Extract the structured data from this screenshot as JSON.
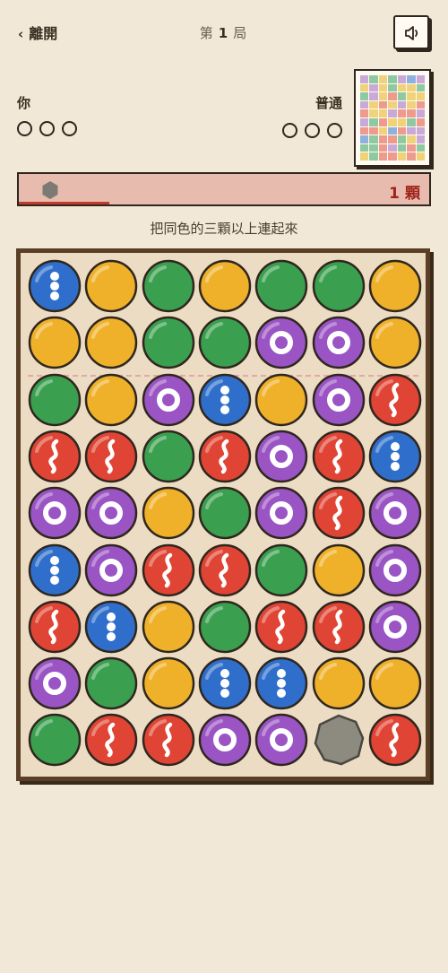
{
  "header": {
    "leave_label": "離開",
    "round_prefix": "第",
    "round_number": "1",
    "round_suffix": "局"
  },
  "players": {
    "you": {
      "label": "你",
      "lives": 3
    },
    "opponent": {
      "label": "普通",
      "lives": 3
    }
  },
  "progress": {
    "count": "1",
    "unit": "顆",
    "fraction": 0.22
  },
  "hint": "把同色的三顆以上連起來",
  "colors": {
    "blue": "#2f6fcb",
    "yellow": "#f0b12a",
    "green": "#3aa04f",
    "purple": "#9a54c4",
    "red": "#e04434",
    "stone": "#8d8a80",
    "board": "#ecdcc4",
    "progress_bg": "#e7bbae"
  },
  "board": {
    "columns": 7,
    "rows": [
      [
        "blue",
        "yellow",
        "green",
        "yellow",
        "green",
        "green",
        "yellow"
      ],
      [
        "yellow",
        "yellow",
        "green",
        "green",
        "purple",
        "purple",
        "yellow"
      ],
      [
        "green",
        "yellow",
        "purple",
        "blue",
        "yellow",
        "purple",
        "red"
      ],
      [
        "red",
        "red",
        "green",
        "red",
        "purple",
        "red",
        "blue"
      ],
      [
        "purple",
        "purple",
        "yellow",
        "green",
        "purple",
        "red",
        "purple"
      ],
      [
        "blue",
        "purple",
        "red",
        "red",
        "green",
        "yellow",
        "purple"
      ],
      [
        "red",
        "blue",
        "yellow",
        "green",
        "red",
        "red",
        "purple"
      ],
      [
        "purple",
        "green",
        "yellow",
        "blue",
        "blue",
        "yellow",
        "yellow"
      ],
      [
        "green",
        "red",
        "red",
        "purple",
        "purple",
        "stone",
        "red"
      ]
    ]
  },
  "minimap": {
    "rows": [
      [
        "purple",
        "green",
        "yellow",
        "green",
        "purple",
        "blue",
        "purple"
      ],
      [
        "yellow",
        "purple",
        "yellow",
        "green",
        "yellow",
        "yellow",
        "green"
      ],
      [
        "green",
        "purple",
        "yellow",
        "red",
        "green",
        "yellow",
        "yellow"
      ],
      [
        "purple",
        "yellow",
        "red",
        "yellow",
        "purple",
        "yellow",
        "red"
      ],
      [
        "red",
        "yellow",
        "yellow",
        "purple",
        "red",
        "red",
        "purple"
      ],
      [
        "purple",
        "green",
        "red",
        "yellow",
        "yellow",
        "green",
        "red"
      ],
      [
        "red",
        "red",
        "yellow",
        "blue",
        "red",
        "purple",
        "purple"
      ],
      [
        "blue",
        "green",
        "red",
        "red",
        "green",
        "yellow",
        "purple"
      ],
      [
        "green",
        "green",
        "red",
        "purple",
        "green",
        "red",
        "green"
      ],
      [
        "yellow",
        "green",
        "red",
        "red",
        "yellow",
        "red",
        "yellow"
      ]
    ]
  }
}
